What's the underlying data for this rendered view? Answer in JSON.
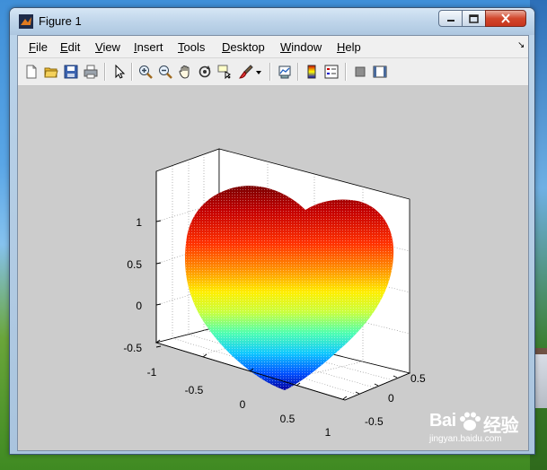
{
  "window": {
    "title": "Figure 1"
  },
  "menu": {
    "items": [
      {
        "label": "File"
      },
      {
        "label": "Edit"
      },
      {
        "label": "View"
      },
      {
        "label": "Insert"
      },
      {
        "label": "Tools"
      },
      {
        "label": "Desktop"
      },
      {
        "label": "Window"
      },
      {
        "label": "Help"
      }
    ],
    "dock_arrow": "↘"
  },
  "toolbar": {
    "buttons": [
      {
        "icon": "new-figure-icon"
      },
      {
        "icon": "open-file-icon"
      },
      {
        "icon": "save-figure-icon"
      },
      {
        "icon": "print-figure-icon"
      },
      {
        "icon": "edit-plot-icon"
      },
      {
        "icon": "zoom-in-icon"
      },
      {
        "icon": "zoom-out-icon"
      },
      {
        "icon": "pan-icon"
      },
      {
        "icon": "rotate-3d-icon"
      },
      {
        "icon": "data-cursor-icon"
      },
      {
        "icon": "brush-icon"
      },
      {
        "icon": "link-plot-icon"
      },
      {
        "icon": "colorbar-icon"
      },
      {
        "icon": "legend-icon"
      },
      {
        "icon": "hide-plot-tools-icon"
      },
      {
        "icon": "show-plot-tools-icon"
      }
    ]
  },
  "axes": {
    "z_ticks": [
      "1",
      "0.5",
      "0",
      "-0.5"
    ],
    "x_ticks": [
      "-1",
      "-0.5",
      "0",
      "0.5",
      "1"
    ],
    "y_ticks": [
      "0.5",
      "0",
      "-0.5"
    ]
  },
  "watermark": {
    "brand": "Bai",
    "brand_suffix": "经验",
    "url": "jingyan.baidu.com"
  },
  "colors": {
    "plot_background": "#cccccc",
    "figure_background": "#d2d2d2",
    "surface_colormap": [
      "#8b0000",
      "#ff2200",
      "#ff9900",
      "#ffff00",
      "#80ff80",
      "#00c0ff",
      "#0000b0"
    ]
  }
}
